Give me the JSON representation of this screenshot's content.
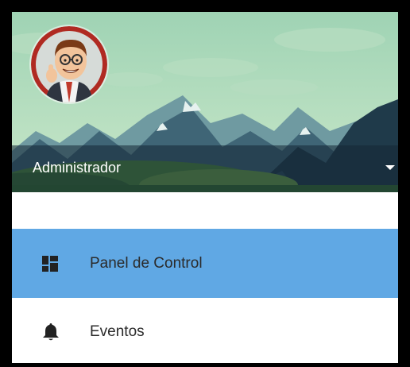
{
  "user": {
    "name": "Administrador"
  },
  "menu": {
    "items": [
      {
        "label": "Panel de Control",
        "icon": "dashboard-icon",
        "active": true
      },
      {
        "label": "Eventos",
        "icon": "bell-icon",
        "active": false
      }
    ]
  },
  "colors": {
    "active_background": "#60a8e4",
    "menu_text": "#2b2b2b",
    "frame": "#000000"
  }
}
